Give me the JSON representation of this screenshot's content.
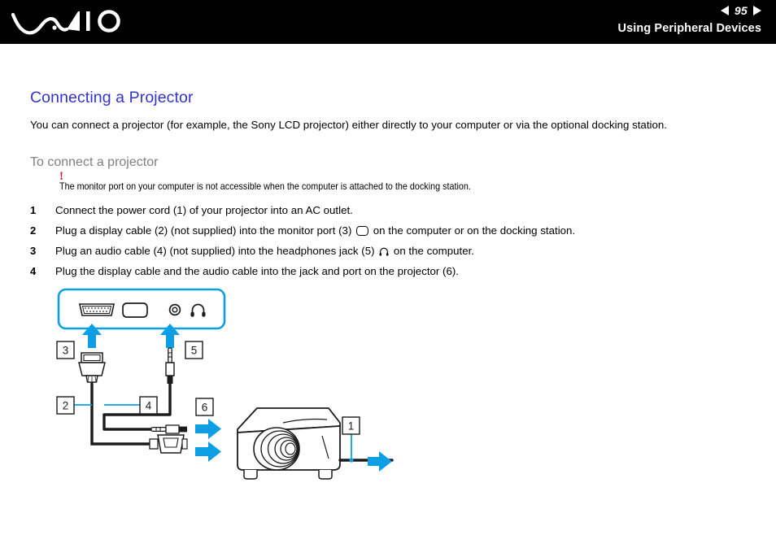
{
  "header": {
    "logo_alt": "VAIO",
    "page_number": "95",
    "prev_arrow": "prev-page-arrow",
    "next_arrow": "next-page-arrow",
    "section_title": "Using Peripheral Devices"
  },
  "page": {
    "heading": "Connecting a Projector",
    "intro": "You can connect a projector (for example, the Sony LCD projector) either directly to your computer or via the optional docking station.",
    "sub_heading": "To connect a projector"
  },
  "note": {
    "mark": "!",
    "text": "The monitor port on your computer is not accessible when the computer is attached to the docking station."
  },
  "steps": [
    {
      "number": "1",
      "text": "Connect the power cord (1) of your projector into an AC outlet."
    },
    {
      "number": "2",
      "text_before": "Plug a display cable (2) (not supplied) into the monitor port (3)",
      "icon": "monitor-port-icon",
      "text_after": "on the computer or on the docking station."
    },
    {
      "number": "3",
      "text_before": "Plug an audio cable (4) (not supplied) into the headphones jack (5)",
      "icon": "headphones-icon",
      "text_after": "on the computer."
    },
    {
      "number": "4",
      "text": "Plug the display cable and the audio cable into the jack and port on the projector (6)."
    }
  ],
  "diagram": {
    "panel_label": "computer-rear-port-panel",
    "ports": [
      {
        "name": "vga-monitor-port",
        "symbol": "d-sub-connector"
      },
      {
        "name": "monitor-port-symbol",
        "symbol": "rounded-rect"
      },
      {
        "name": "microphone-jack",
        "symbol": "circle-jack"
      },
      {
        "name": "headphones-jack",
        "symbol": "headphones"
      }
    ],
    "callouts": [
      {
        "id": "3",
        "target": "monitor-port-on-computer"
      },
      {
        "id": "5",
        "target": "headphones-jack-on-computer"
      },
      {
        "id": "2",
        "target": "display-cable"
      },
      {
        "id": "4",
        "target": "audio-cable"
      },
      {
        "id": "6",
        "target": "projector-jack-and-port"
      },
      {
        "id": "1",
        "target": "power-cord"
      }
    ],
    "device": "projector",
    "accent_color": "#0c9fe3",
    "line_color": "#000000"
  },
  "colors": {
    "heading_blue": "#3333cc",
    "sub_heading_gray": "#808080",
    "note_red": "#d8151c",
    "accent_cyan": "#0c9fe3",
    "header_bg": "#000000"
  }
}
